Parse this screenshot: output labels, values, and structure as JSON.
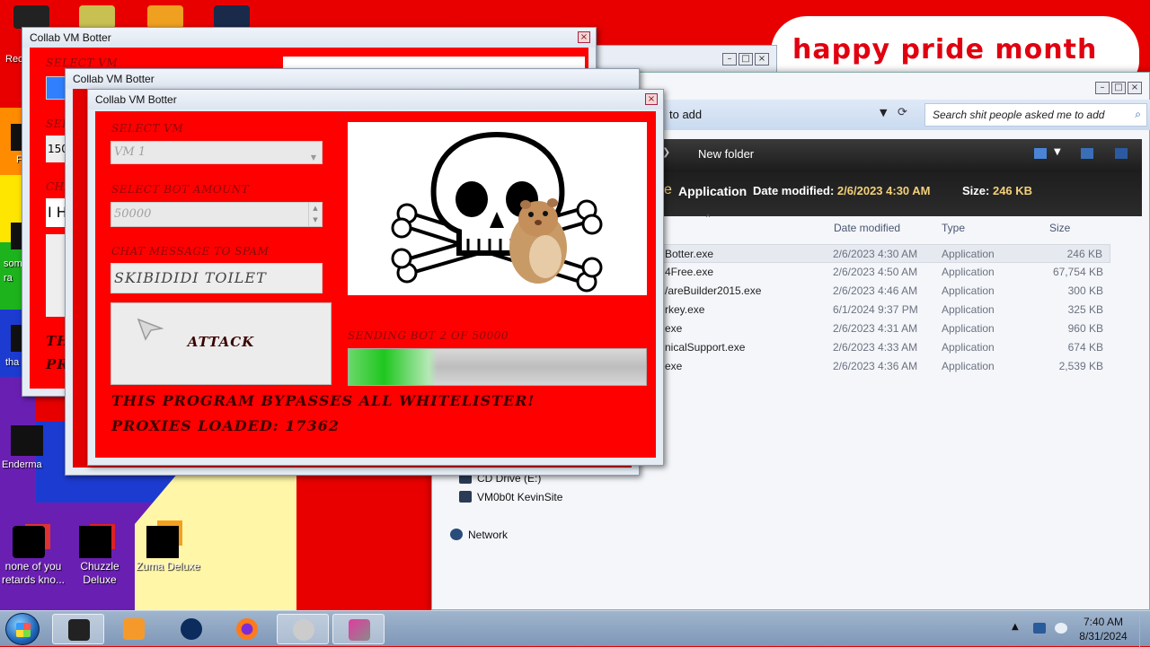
{
  "desktop": {
    "banner_text": "happy pride month",
    "icons": [
      {
        "label": "none of you retards kno..."
      },
      {
        "label": "Chuzzle Deluxe"
      },
      {
        "label": "Zuma Deluxe"
      }
    ],
    "partial_labels": [
      "Rec",
      "F",
      "som ra",
      "tha",
      "Enderma"
    ]
  },
  "explorer": {
    "address_path": "to add",
    "search_placeholder": "Search shit people asked me to add",
    "toolbar": {
      "new_folder": "New folder"
    },
    "details": {
      "type": "Application",
      "modified_label": "Date modified:",
      "modified_value": "2/6/2023 4:30 AM",
      "size_label": "Size:",
      "size_value": "246 KB"
    },
    "columns": {
      "date": "Date modified",
      "type": "Type",
      "size": "Size"
    },
    "rows": [
      {
        "name": "Botter.exe",
        "date": "2/6/2023 4:30 AM",
        "type": "Application",
        "size": "246 KB",
        "selected": true
      },
      {
        "name": "4Free.exe",
        "date": "2/6/2023 4:50 AM",
        "type": "Application",
        "size": "67,754 KB"
      },
      {
        "name": "/areBuilder2015.exe",
        "date": "2/6/2023 4:46 AM",
        "type": "Application",
        "size": "300 KB"
      },
      {
        "name": "rkey.exe",
        "date": "6/1/2024 9:37 PM",
        "type": "Application",
        "size": "325 KB"
      },
      {
        "name": "exe",
        "date": "2/6/2023 4:31 AM",
        "type": "Application",
        "size": "960 KB"
      },
      {
        "name": "nicalSupport.exe",
        "date": "2/6/2023 4:33 AM",
        "type": "Application",
        "size": "674 KB"
      },
      {
        "name": "exe",
        "date": "2/6/2023 4:36 AM",
        "type": "Application",
        "size": "2,539 KB"
      }
    ],
    "nav": [
      {
        "label": "CD Drive (E:)"
      },
      {
        "label": "VM0b0t KevinSite"
      },
      {
        "label": "Network"
      }
    ]
  },
  "botter_back1": {
    "title": "Collab VM Botter",
    "labels": [
      "SELECT VM",
      "SELE",
      "CHA",
      "THI",
      "PR"
    ],
    "value_partial": "150",
    "chat_partial": "I H"
  },
  "botter_back2": {
    "title": "Collab VM Botter"
  },
  "botter": {
    "title": "Collab VM Botter",
    "select_vm_label": "SELECT VM",
    "select_vm_value": "VM 1",
    "bot_amount_label": "SELECT BOT AMOUNT",
    "bot_amount_value": "50000",
    "chat_label": "CHAT MESSAGE TO SPAM",
    "chat_value": "SKIBIDIDI TOILET",
    "attack_label": "ATTACK",
    "status_text": "SENDING BOT 2 OF 50000",
    "progress": 0.3,
    "bypass_text": "THIS PROGRAM BYPASSES ALL WHITELISTER!",
    "proxies_text": "PROXIES LOADED: 17362"
  },
  "taskbar": {
    "time": "7:40 AM",
    "date": "8/31/2024"
  }
}
